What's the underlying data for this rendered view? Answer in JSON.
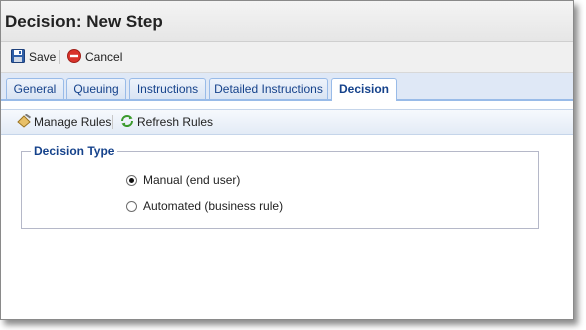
{
  "window": {
    "title": "Decision: New Step"
  },
  "toolbar": {
    "save_label": "Save",
    "cancel_label": "Cancel"
  },
  "tabs": [
    {
      "label": "General"
    },
    {
      "label": "Queuing"
    },
    {
      "label": "Instructions"
    },
    {
      "label": "Detailed Instructions"
    },
    {
      "label": "Decision",
      "active": true
    }
  ],
  "rules_toolbar": {
    "manage_label": "Manage Rules",
    "refresh_label": "Refresh Rules"
  },
  "decision_type": {
    "legend": "Decision Type",
    "options": [
      {
        "label": "Manual (end user)",
        "selected": true
      },
      {
        "label": "Automated (business rule)",
        "selected": false
      }
    ]
  },
  "icons": {
    "save": "floppy-disk-icon",
    "cancel": "cancel-circle-icon",
    "manage": "rules-edit-icon",
    "refresh": "refresh-icon"
  },
  "colors": {
    "accent": "#15428b",
    "tab_border": "#99bbe8",
    "cancel_red": "#d9332b",
    "refresh_green": "#3a9a2c"
  }
}
